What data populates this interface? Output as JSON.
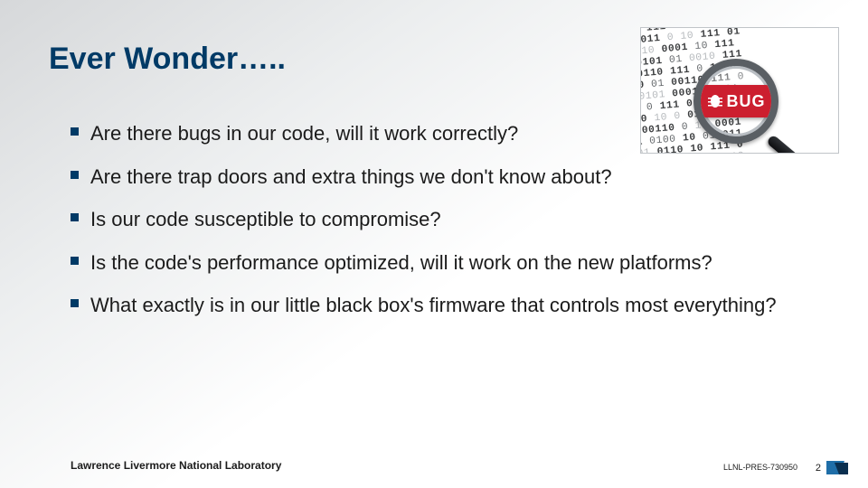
{
  "title": "Ever Wonder…..",
  "bullets": [
    "Are there bugs in our code, will it work correctly?",
    "Are there trap doors and extra things we don't know about?",
    "Is our code susceptible to compromise?",
    "Is the code's performance optimized, will it work on the new platforms?",
    "What exactly is in our little black box's firmware that controls most everything?"
  ],
  "graphic": {
    "badge_text": "BUG"
  },
  "footer": {
    "org": "Lawrence Livermore National Laboratory",
    "ref": "LLNL-PRES-730950",
    "page": "2"
  }
}
